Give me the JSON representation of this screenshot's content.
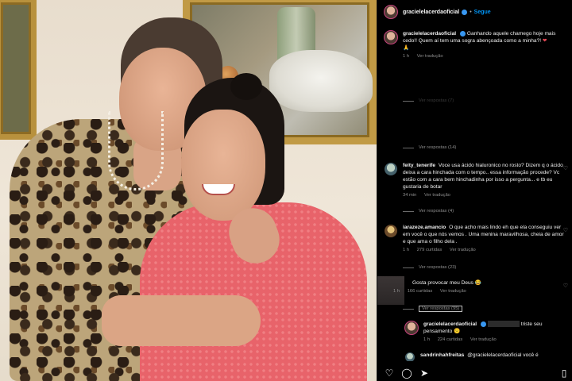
{
  "post": {
    "username": "gracielelacerdaoficial",
    "follow_label": "Segue",
    "dot": "•"
  },
  "caption": {
    "user": "gracielelacerdaoficial",
    "text": "Ganhando aquele chamego hoje mais cedo!! Quem aí tem uma sogra abençoada como a minha?!",
    "emoji_heart": "❤",
    "emoji_hands": "🙏",
    "time": "1 h",
    "reply_label": "Ver tradução"
  },
  "hidden_replies_top": "Ver respostas (7)",
  "replies_14": "Ver respostas (14)",
  "comments": [
    {
      "user": "feity_tenerife",
      "text": "Voce usa ácido hialuronico no rosto? Dizem q o ácido deixa a cara hinchada com o tempo.. essa informação procede? Vc estão com a cara bem hinchadinha por isso a pergunta... e tb eu gustaria de botar",
      "time": "34 min",
      "translate": "Ver tradução",
      "replies": "Ver respostas (4)"
    },
    {
      "user": "iarazeze.amancio",
      "text": "O que acho mais lindo eh que ela conseguiu ver em você o que nós vemos . Uma menina maravilhosa, cheia de amor e que ama o filho dela .",
      "time": "1 h",
      "likes": "279 curtidas",
      "translate": "Ver tradução",
      "replies": "Ver respostas (23)"
    },
    {
      "user": "",
      "text": "Gosta provocar meu Deus",
      "emoji": "😂",
      "time": "1 h",
      "likes": "166 curtidas",
      "translate": "Ver tradução",
      "replies": "Ver respostas (95)"
    },
    {
      "user": "gracielelacerdaoficial",
      "text": "triste seu pensamento",
      "emoji": "😕",
      "time": "1 h",
      "likes": "224 curtidas",
      "translate": "Ver tradução"
    },
    {
      "user": "sandrinhahfreitas",
      "text": "@gracielelacerdaoficial você é"
    }
  ],
  "icons": {
    "heart": "heart-icon",
    "comment": "comment-icon",
    "share": "share-icon",
    "save": "bookmark-icon"
  }
}
